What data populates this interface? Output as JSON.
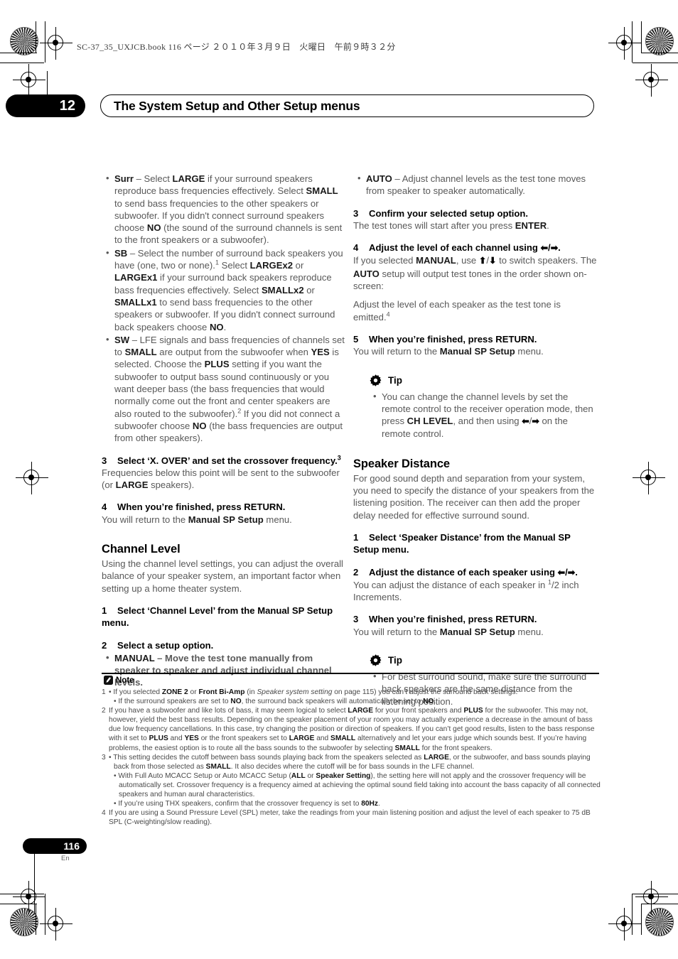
{
  "header": {
    "file_line": "SC-37_35_UXJCB.book   116 ページ   ２０１０年３月９日　火曜日　午前９時３２分",
    "chapter_number": "12",
    "chapter_title": "The System Setup and Other Setup menus"
  },
  "left_column": {
    "bullets": [
      {
        "term": "Surr",
        "html": "<b>Surr</b> – Select <b>LARGE</b> if your surround speakers reproduce bass frequencies effectively. Select <b>SMALL</b> to send bass frequencies to the other speakers or subwoofer. If you didn't connect surround speakers choose <b>NO</b> (the sound of the surround channels is sent to the front speakers or a subwoofer)."
      },
      {
        "term": "SB",
        "html": "<b>SB</b> – Select the number of surround back speakers you have (one, two or none).<sup>1</sup> Select <b>LARGEx2</b> or <b>LARGEx1</b> if your surround back speakers reproduce bass frequencies effectively. Select <b>SMALLx2</b> or <b>SMALLx1</b> to send bass frequencies to the other speakers or subwoofer. If you didn't connect surround back speakers choose <b>NO</b>."
      },
      {
        "term": "SW",
        "html": "<b>SW</b> – LFE signals and bass frequencies of channels set to <b>SMALL</b> are output from the subwoofer when <b>YES</b> is selected. Choose the <b>PLUS</b> setting if you want the subwoofer to output bass sound continuously or you want deeper bass (the bass frequencies that would normally come out the front and center speakers are also routed to the subwoofer).<sup>2</sup> If you did not connect a subwoofer choose <b>NO</b> (the bass frequencies are output from other speakers)."
      }
    ],
    "step3": {
      "num": "3",
      "title_html": "Select ‘X. OVER’ and set the crossover frequency.<sup>3</sup>",
      "body_html": "Frequencies below this point will be sent to the subwoofer (or <b>LARGE</b> speakers)."
    },
    "step4": {
      "num": "4",
      "title": "When you’re finished, press RETURN.",
      "body_html": "You will return to the <b>Manual SP Setup</b> menu."
    },
    "section_title": "Channel Level",
    "section_intro": "Using the channel level settings, you can adjust the overall balance of your speaker system, an important factor when setting up a home theater system.",
    "cl_step1": {
      "num": "1",
      "title": "Select ‘Channel Level’ from the Manual SP Setup menu."
    },
    "cl_step2": {
      "num": "2",
      "title": "Select a setup option.",
      "bullet_html": "<b>MANUAL</b> – Move the test tone manually from speaker to speaker and adjust individual channel levels."
    }
  },
  "right_column": {
    "auto_bullet_html": "<b>AUTO</b> – Adjust channel levels as the test tone moves from speaker to speaker automatically.",
    "step3": {
      "num": "3",
      "title": "Confirm your selected setup option.",
      "body_html": "The test tones will start after you press <b>ENTER</b>."
    },
    "step4": {
      "num": "4",
      "title_html": "Adjust the level of each channel using <span class=\"arrow\">&#11013;</span>/<span class=\"arrow\">&#10145;</span>.",
      "body_html": "If you selected <b>MANUAL</b>, use <span class=\"arrow\">&#11014;</span>/<span class=\"arrow\">&#11015;</span> to switch speakers. The <b>AUTO</b> setup will output test tones in the order shown on-screen:",
      "body2_html": "Adjust the level of each speaker as the test tone is emitted.<sup>4</sup>"
    },
    "step5": {
      "num": "5",
      "title": "When you’re finished, press RETURN.",
      "body_html": "You will return to the <b>Manual SP Setup</b> menu."
    },
    "tip1": {
      "label": "Tip",
      "bullet_html": "You can change the channel levels by set the remote control to the receiver operation mode, then press <b>CH LEVEL</b>, and then using <span class=\"arrow\">&#11013;</span>/<span class=\"arrow\">&#10145;</span> on the remote control."
    },
    "section_title": "Speaker Distance",
    "section_intro": "For good sound depth and separation from your system, you need to specify the distance of your speakers from the listening position. The receiver can then add the proper delay needed for effective surround sound.",
    "sd_step1": {
      "num": "1",
      "title": "Select ‘Speaker Distance’ from the Manual SP Setup menu."
    },
    "sd_step2": {
      "num": "2",
      "title_html": "Adjust the distance of each speaker using <span class=\"arrow\">&#11013;</span>/<span class=\"arrow\">&#10145;</span>.",
      "body_html": "You can adjust the distance of each speaker in <sup>1</sup>/2 inch Increments."
    },
    "sd_step3": {
      "num": "3",
      "title": "When you’re finished, press RETURN.",
      "body_html": "You will return to the <b>Manual SP Setup</b> menu."
    },
    "tip2": {
      "label": "Tip",
      "bullet_html": "For best surround sound, make sure the surround back speakers are the same distance from the listening position."
    }
  },
  "notes": {
    "label": "Note",
    "items": [
      {
        "index": "1",
        "lines": [
          "• If you selected <b>ZONE 2</b> or <b>Front Bi-Amp</b> (in <i>Speaker system setting</i> on page 115) you can’t adjust the surround back settings.",
          "• If the surround speakers are set to <b>NO</b>, the surround back speakers will automatically be set to <b>NO</b>."
        ]
      },
      {
        "index": "2",
        "lines": [
          "If you have a subwoofer and like lots of bass, it may seem logical to select <b>LARGE</b> for your front speakers and <b>PLUS</b> for the subwoofer. This may not, however, yield the best bass results. Depending on the speaker placement of your room you may actually experience a decrease in the amount of bass due low frequency cancellations. In this case, try changing the position or direction of speakers. If you can’t get good results, listen to the bass response with it set to <b>PLUS</b> and <b>YES</b> or the front speakers set to <b>LARGE</b> and <b>SMALL</b> alternatively and let your ears judge which sounds best. If you’re having problems, the easiest option is to route all the bass sounds to the subwoofer by selecting <b>SMALL</b> for the front speakers."
        ]
      },
      {
        "index": "3",
        "lines": [
          "• This setting decides the cutoff between bass sounds playing back from the speakers selected as <b>LARGE</b>, or the subwoofer, and bass sounds playing back from those selected as <b>SMALL</b>. It also decides where the cutoff will be for bass sounds in the LFE channel.",
          "• With Full Auto MCACC Setup or Auto MCACC Setup (<b>ALL</b> or <b>Speaker Setting</b>), the setting here will not apply and the crossover frequency will be automatically set. Crossover frequency is a frequency aimed at achieving the optimal sound field taking into account the bass capacity of all connected speakers and human aural characteristics.",
          "• If you’re using THX speakers, confirm that the crossover frequency is set to <b>80Hz</b>."
        ]
      },
      {
        "index": "4",
        "lines": [
          "If you are using a Sound Pressure Level (SPL) meter, take the readings from your main listening position and adjust the level of each speaker to 75 dB SPL (C-weighting/slow reading)."
        ]
      }
    ]
  },
  "footer": {
    "page_number": "116",
    "language": "En"
  },
  "colors": {
    "ink_black": "#000000",
    "body_gray": "#595959",
    "bold_gray": "#1a1a1a"
  }
}
